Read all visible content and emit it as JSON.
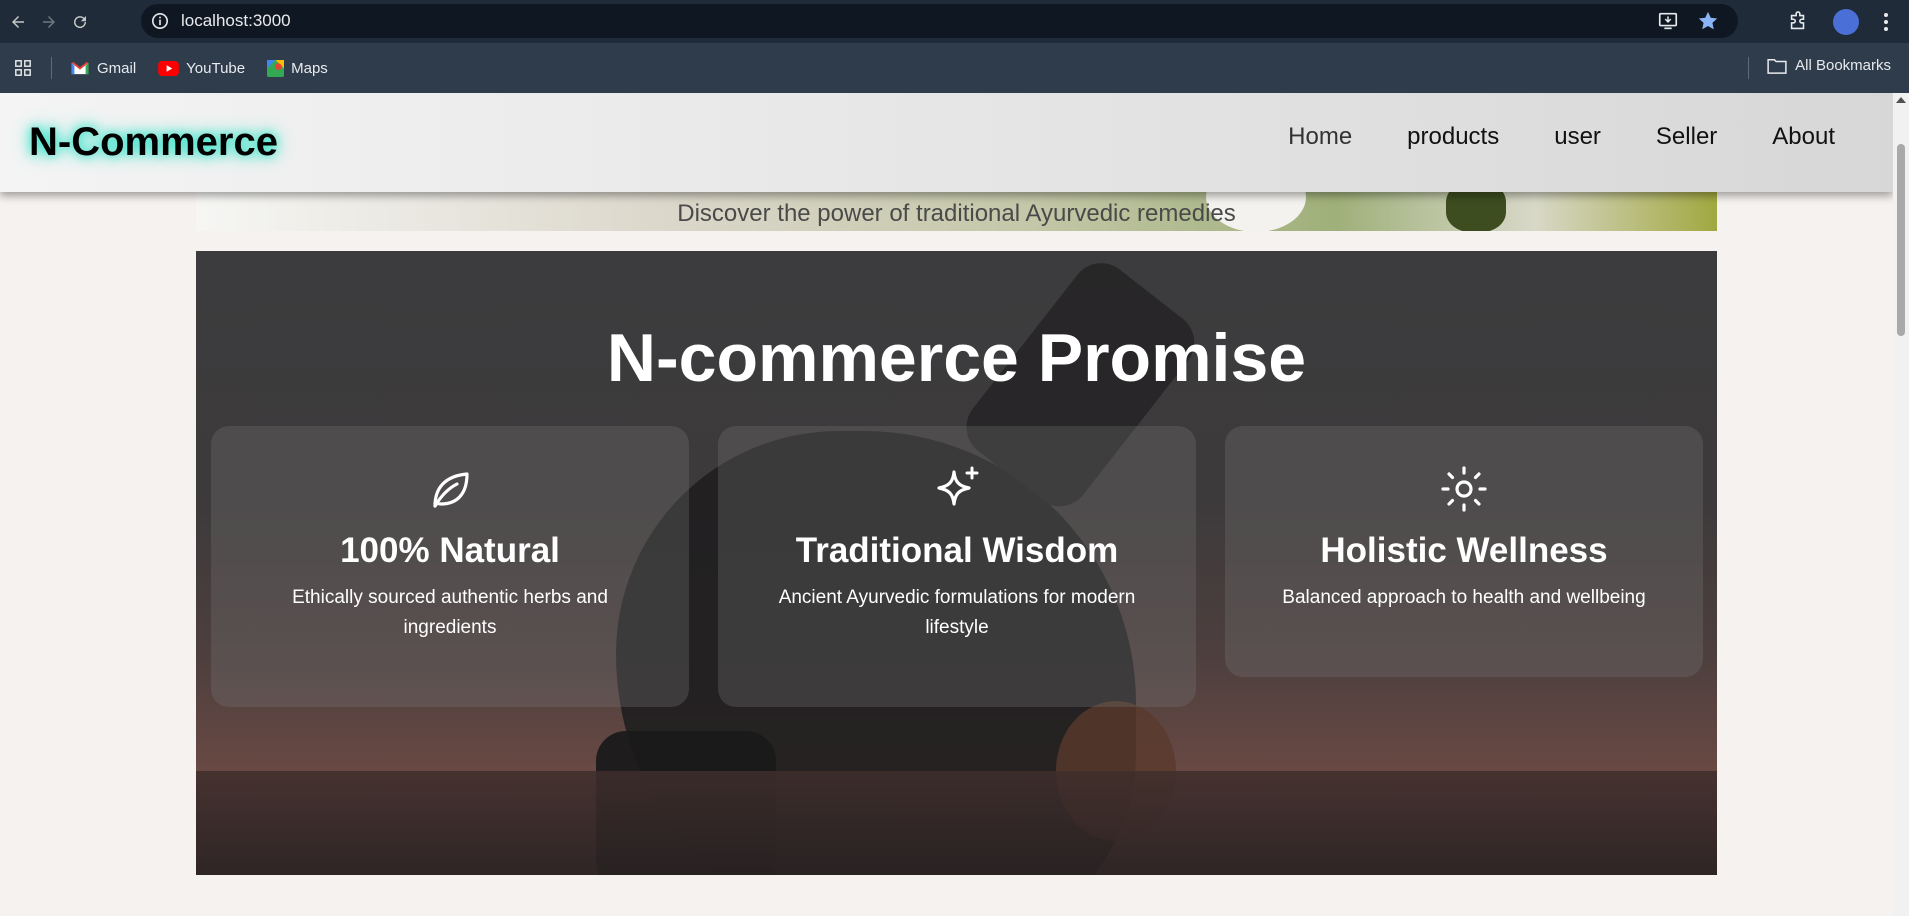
{
  "browser": {
    "url": "localhost:3000",
    "bookmarks": [
      {
        "label": "Gmail",
        "icon": "gmail-icon"
      },
      {
        "label": "YouTube",
        "icon": "youtube-icon"
      },
      {
        "label": "Maps",
        "icon": "maps-icon"
      }
    ],
    "all_bookmarks": "All Bookmarks"
  },
  "header": {
    "logo": "N-Commerce",
    "nav": [
      "Home",
      "products",
      "user",
      "Seller",
      "About"
    ]
  },
  "hero": {
    "subtitle": "Discover the power of traditional Ayurvedic remedies"
  },
  "promise": {
    "title": "N-commerce Promise",
    "cards": [
      {
        "icon": "leaf-icon",
        "title": "100% Natural",
        "text": "Ethically sourced authentic herbs and ingredients"
      },
      {
        "icon": "sparkle-icon",
        "title": "Traditional Wisdom",
        "text": "Ancient Ayurvedic formulations for modern lifestyle"
      },
      {
        "icon": "sun-icon",
        "title": "Holistic Wellness",
        "text": "Balanced approach to health and wellbeing"
      }
    ]
  },
  "colors": {
    "accent_glow": "#2fe3c8",
    "chrome_dark": "#1f2b38"
  }
}
